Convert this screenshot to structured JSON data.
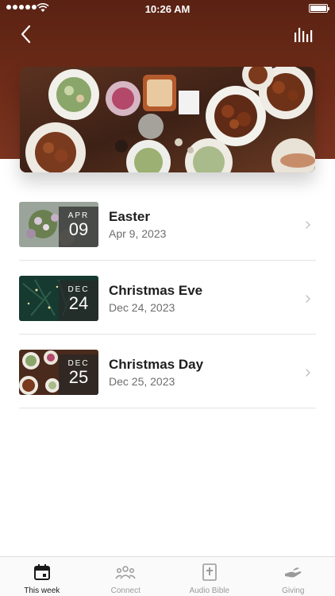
{
  "status_bar": {
    "time": "10:26 AM"
  },
  "header": {
    "back_icon": "chevron-left-icon",
    "stats_icon": "bar-chart-icon"
  },
  "colors": {
    "header_brown": "#6b2a17",
    "text_dark": "#1e1e1e",
    "text_gray": "#6d6d6d",
    "tab_inactive": "#9a9a9a"
  },
  "events": [
    {
      "month": "APR",
      "day": "09",
      "title": "Easter",
      "date": "Apr 9, 2023"
    },
    {
      "month": "DEC",
      "day": "24",
      "title": "Christmas Eve",
      "date": "Dec 24, 2023"
    },
    {
      "month": "DEC",
      "day": "25",
      "title": "Christmas Day",
      "date": "Dec 25, 2023"
    }
  ],
  "tabs": [
    {
      "label": "This week",
      "icon": "calendar-icon",
      "active": true
    },
    {
      "label": "Connect",
      "icon": "people-icon",
      "active": false
    },
    {
      "label": "Audio Bible",
      "icon": "bible-icon",
      "active": false
    },
    {
      "label": "Giving",
      "icon": "giving-hand-icon",
      "active": false
    }
  ]
}
